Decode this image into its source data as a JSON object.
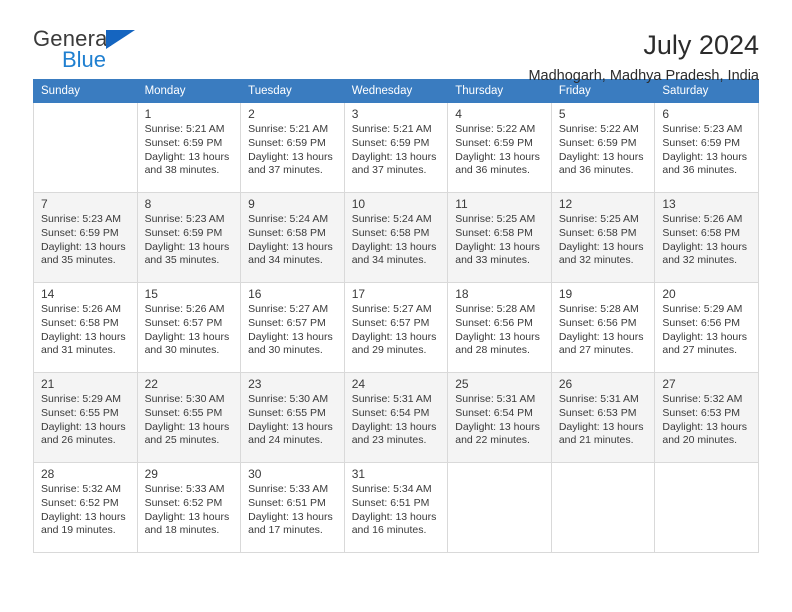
{
  "brand": {
    "name_part1": "General",
    "name_part2": "Blue",
    "logo_icon": "triangle-logo-icon",
    "accent_color": "#1565c0"
  },
  "header": {
    "title": "July 2024",
    "subtitle": "Madhogarh, Madhya Pradesh, India"
  },
  "calendar": {
    "header_background": "#3a7cc0",
    "weekdays": [
      "Sunday",
      "Monday",
      "Tuesday",
      "Wednesday",
      "Thursday",
      "Friday",
      "Saturday"
    ],
    "labels": {
      "sunrise": "Sunrise:",
      "sunset": "Sunset:",
      "daylight": "Daylight:"
    },
    "weeks": [
      {
        "shaded": false,
        "days": [
          {
            "num": "",
            "sunrise": "",
            "sunset": "",
            "daylight_line1": "",
            "daylight_line2": "",
            "empty": true
          },
          {
            "num": "1",
            "sunrise": "Sunrise: 5:21 AM",
            "sunset": "Sunset: 6:59 PM",
            "daylight_line1": "Daylight: 13 hours",
            "daylight_line2": "and 38 minutes.",
            "empty": false
          },
          {
            "num": "2",
            "sunrise": "Sunrise: 5:21 AM",
            "sunset": "Sunset: 6:59 PM",
            "daylight_line1": "Daylight: 13 hours",
            "daylight_line2": "and 37 minutes.",
            "empty": false
          },
          {
            "num": "3",
            "sunrise": "Sunrise: 5:21 AM",
            "sunset": "Sunset: 6:59 PM",
            "daylight_line1": "Daylight: 13 hours",
            "daylight_line2": "and 37 minutes.",
            "empty": false
          },
          {
            "num": "4",
            "sunrise": "Sunrise: 5:22 AM",
            "sunset": "Sunset: 6:59 PM",
            "daylight_line1": "Daylight: 13 hours",
            "daylight_line2": "and 36 minutes.",
            "empty": false
          },
          {
            "num": "5",
            "sunrise": "Sunrise: 5:22 AM",
            "sunset": "Sunset: 6:59 PM",
            "daylight_line1": "Daylight: 13 hours",
            "daylight_line2": "and 36 minutes.",
            "empty": false
          },
          {
            "num": "6",
            "sunrise": "Sunrise: 5:23 AM",
            "sunset": "Sunset: 6:59 PM",
            "daylight_line1": "Daylight: 13 hours",
            "daylight_line2": "and 36 minutes.",
            "empty": false
          }
        ]
      },
      {
        "shaded": true,
        "days": [
          {
            "num": "7",
            "sunrise": "Sunrise: 5:23 AM",
            "sunset": "Sunset: 6:59 PM",
            "daylight_line1": "Daylight: 13 hours",
            "daylight_line2": "and 35 minutes.",
            "empty": false
          },
          {
            "num": "8",
            "sunrise": "Sunrise: 5:23 AM",
            "sunset": "Sunset: 6:59 PM",
            "daylight_line1": "Daylight: 13 hours",
            "daylight_line2": "and 35 minutes.",
            "empty": false
          },
          {
            "num": "9",
            "sunrise": "Sunrise: 5:24 AM",
            "sunset": "Sunset: 6:58 PM",
            "daylight_line1": "Daylight: 13 hours",
            "daylight_line2": "and 34 minutes.",
            "empty": false
          },
          {
            "num": "10",
            "sunrise": "Sunrise: 5:24 AM",
            "sunset": "Sunset: 6:58 PM",
            "daylight_line1": "Daylight: 13 hours",
            "daylight_line2": "and 34 minutes.",
            "empty": false
          },
          {
            "num": "11",
            "sunrise": "Sunrise: 5:25 AM",
            "sunset": "Sunset: 6:58 PM",
            "daylight_line1": "Daylight: 13 hours",
            "daylight_line2": "and 33 minutes.",
            "empty": false
          },
          {
            "num": "12",
            "sunrise": "Sunrise: 5:25 AM",
            "sunset": "Sunset: 6:58 PM",
            "daylight_line1": "Daylight: 13 hours",
            "daylight_line2": "and 32 minutes.",
            "empty": false
          },
          {
            "num": "13",
            "sunrise": "Sunrise: 5:26 AM",
            "sunset": "Sunset: 6:58 PM",
            "daylight_line1": "Daylight: 13 hours",
            "daylight_line2": "and 32 minutes.",
            "empty": false
          }
        ]
      },
      {
        "shaded": false,
        "days": [
          {
            "num": "14",
            "sunrise": "Sunrise: 5:26 AM",
            "sunset": "Sunset: 6:58 PM",
            "daylight_line1": "Daylight: 13 hours",
            "daylight_line2": "and 31 minutes.",
            "empty": false
          },
          {
            "num": "15",
            "sunrise": "Sunrise: 5:26 AM",
            "sunset": "Sunset: 6:57 PM",
            "daylight_line1": "Daylight: 13 hours",
            "daylight_line2": "and 30 minutes.",
            "empty": false
          },
          {
            "num": "16",
            "sunrise": "Sunrise: 5:27 AM",
            "sunset": "Sunset: 6:57 PM",
            "daylight_line1": "Daylight: 13 hours",
            "daylight_line2": "and 30 minutes.",
            "empty": false
          },
          {
            "num": "17",
            "sunrise": "Sunrise: 5:27 AM",
            "sunset": "Sunset: 6:57 PM",
            "daylight_line1": "Daylight: 13 hours",
            "daylight_line2": "and 29 minutes.",
            "empty": false
          },
          {
            "num": "18",
            "sunrise": "Sunrise: 5:28 AM",
            "sunset": "Sunset: 6:56 PM",
            "daylight_line1": "Daylight: 13 hours",
            "daylight_line2": "and 28 minutes.",
            "empty": false
          },
          {
            "num": "19",
            "sunrise": "Sunrise: 5:28 AM",
            "sunset": "Sunset: 6:56 PM",
            "daylight_line1": "Daylight: 13 hours",
            "daylight_line2": "and 27 minutes.",
            "empty": false
          },
          {
            "num": "20",
            "sunrise": "Sunrise: 5:29 AM",
            "sunset": "Sunset: 6:56 PM",
            "daylight_line1": "Daylight: 13 hours",
            "daylight_line2": "and 27 minutes.",
            "empty": false
          }
        ]
      },
      {
        "shaded": true,
        "days": [
          {
            "num": "21",
            "sunrise": "Sunrise: 5:29 AM",
            "sunset": "Sunset: 6:55 PM",
            "daylight_line1": "Daylight: 13 hours",
            "daylight_line2": "and 26 minutes.",
            "empty": false
          },
          {
            "num": "22",
            "sunrise": "Sunrise: 5:30 AM",
            "sunset": "Sunset: 6:55 PM",
            "daylight_line1": "Daylight: 13 hours",
            "daylight_line2": "and 25 minutes.",
            "empty": false
          },
          {
            "num": "23",
            "sunrise": "Sunrise: 5:30 AM",
            "sunset": "Sunset: 6:55 PM",
            "daylight_line1": "Daylight: 13 hours",
            "daylight_line2": "and 24 minutes.",
            "empty": false
          },
          {
            "num": "24",
            "sunrise": "Sunrise: 5:31 AM",
            "sunset": "Sunset: 6:54 PM",
            "daylight_line1": "Daylight: 13 hours",
            "daylight_line2": "and 23 minutes.",
            "empty": false
          },
          {
            "num": "25",
            "sunrise": "Sunrise: 5:31 AM",
            "sunset": "Sunset: 6:54 PM",
            "daylight_line1": "Daylight: 13 hours",
            "daylight_line2": "and 22 minutes.",
            "empty": false
          },
          {
            "num": "26",
            "sunrise": "Sunrise: 5:31 AM",
            "sunset": "Sunset: 6:53 PM",
            "daylight_line1": "Daylight: 13 hours",
            "daylight_line2": "and 21 minutes.",
            "empty": false
          },
          {
            "num": "27",
            "sunrise": "Sunrise: 5:32 AM",
            "sunset": "Sunset: 6:53 PM",
            "daylight_line1": "Daylight: 13 hours",
            "daylight_line2": "and 20 minutes.",
            "empty": false
          }
        ]
      },
      {
        "shaded": false,
        "days": [
          {
            "num": "28",
            "sunrise": "Sunrise: 5:32 AM",
            "sunset": "Sunset: 6:52 PM",
            "daylight_line1": "Daylight: 13 hours",
            "daylight_line2": "and 19 minutes.",
            "empty": false
          },
          {
            "num": "29",
            "sunrise": "Sunrise: 5:33 AM",
            "sunset": "Sunset: 6:52 PM",
            "daylight_line1": "Daylight: 13 hours",
            "daylight_line2": "and 18 minutes.",
            "empty": false
          },
          {
            "num": "30",
            "sunrise": "Sunrise: 5:33 AM",
            "sunset": "Sunset: 6:51 PM",
            "daylight_line1": "Daylight: 13 hours",
            "daylight_line2": "and 17 minutes.",
            "empty": false
          },
          {
            "num": "31",
            "sunrise": "Sunrise: 5:34 AM",
            "sunset": "Sunset: 6:51 PM",
            "daylight_line1": "Daylight: 13 hours",
            "daylight_line2": "and 16 minutes.",
            "empty": false
          },
          {
            "num": "",
            "sunrise": "",
            "sunset": "",
            "daylight_line1": "",
            "daylight_line2": "",
            "empty": true
          },
          {
            "num": "",
            "sunrise": "",
            "sunset": "",
            "daylight_line1": "",
            "daylight_line2": "",
            "empty": true
          },
          {
            "num": "",
            "sunrise": "",
            "sunset": "",
            "daylight_line1": "",
            "daylight_line2": "",
            "empty": true
          }
        ]
      }
    ]
  }
}
